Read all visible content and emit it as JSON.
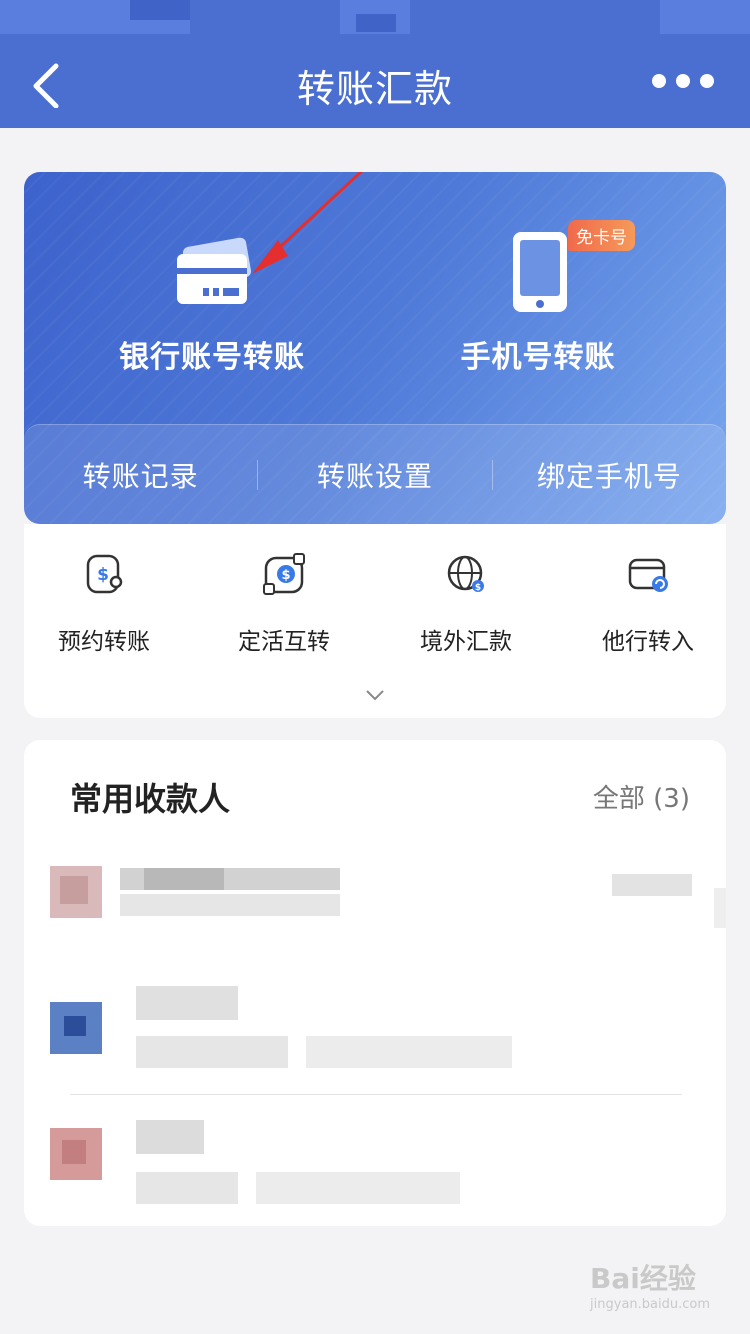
{
  "nav": {
    "title": "转账汇款"
  },
  "hero": {
    "bank_transfer_label": "银行账号转账",
    "phone_transfer_label": "手机号转账",
    "phone_badge": "免卡号",
    "sub_actions": [
      "转账记录",
      "转账设置",
      "绑定手机号"
    ]
  },
  "quick": {
    "items": [
      {
        "label": "预约转账",
        "icon": "scheduled-transfer-icon"
      },
      {
        "label": "定活互转",
        "icon": "fixed-current-switch-icon"
      },
      {
        "label": "境外汇款",
        "icon": "overseas-remittance-icon"
      },
      {
        "label": "他行转入",
        "icon": "other-bank-transfer-in-icon"
      }
    ]
  },
  "payees": {
    "title": "常用收款人",
    "all_label": "全部 (3)"
  },
  "watermark": {
    "brand": "Bai经验",
    "url": "jingyan.baidu.com"
  },
  "colors": {
    "primary": "#4a6fd0",
    "badge": "#f06a4b",
    "icon_accent": "#3a7ae8"
  }
}
